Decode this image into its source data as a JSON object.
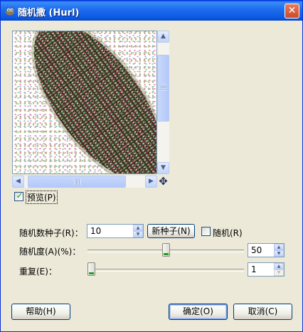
{
  "window": {
    "title": "随机撒 (Hurl)"
  },
  "icons": {
    "title": "gimp-icon",
    "close": "close-icon",
    "navigate": "navigate-icon"
  },
  "preview": {
    "checkbox_label": "预览(P)",
    "checked": true
  },
  "seed": {
    "label": "随机数种子(R)：",
    "value": "10",
    "new_seed_label": "新种子(N)",
    "randomize_label": "随机(R)",
    "randomize_checked": false
  },
  "randomization": {
    "label": "随机度(A)(%)：",
    "value": "50",
    "fraction": 0.5
  },
  "repeat": {
    "label": "重复(E)：",
    "value": "1",
    "fraction": 0.0
  },
  "buttons": {
    "help": "帮助(H)",
    "ok": "确定(O)",
    "cancel": "取消(C)"
  },
  "colors": {
    "titlebar": "#0a58e0",
    "dialog_bg": "#ece9d8",
    "accent_green": "#21a121"
  }
}
